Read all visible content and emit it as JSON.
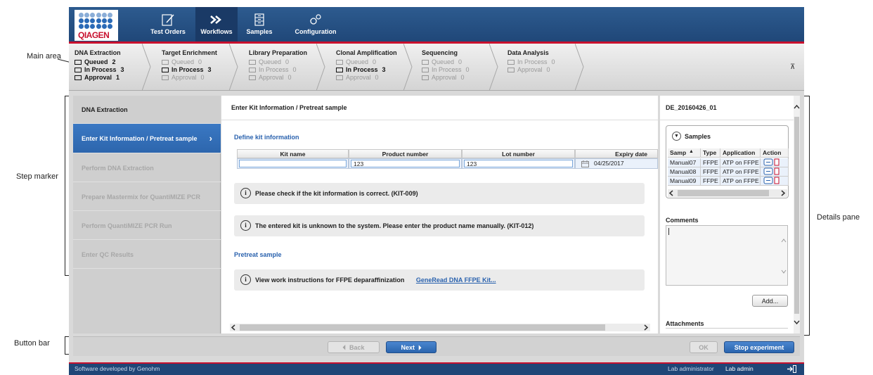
{
  "callouts": {
    "main_area": "Main area",
    "step_marker": "Step marker",
    "details_pane": "Details pane",
    "button_bar": "Button bar"
  },
  "brand": {
    "logo_text": "QIAGEN",
    "color_primary": "#1f4677",
    "color_accent": "#c8102e",
    "color_link": "#2a62ae"
  },
  "nav": [
    {
      "label": "Test Orders",
      "icon": "pencil-icon"
    },
    {
      "label": "Workflows",
      "icon": "double-chevron-icon",
      "active": true
    },
    {
      "label": "Samples",
      "icon": "cabinet-icon"
    },
    {
      "label": "Configuration",
      "icon": "gears-icon"
    }
  ],
  "stages": [
    {
      "name": "DNA Extraction",
      "rows": [
        {
          "label": "Queued",
          "count": "2",
          "on": true
        },
        {
          "label": "In Process",
          "count": "3",
          "on": true
        },
        {
          "label": "Approval",
          "count": "1",
          "on": true
        }
      ]
    },
    {
      "name": "Target Enrichment",
      "rows": [
        {
          "label": "Queued",
          "count": "0"
        },
        {
          "label": "In Process",
          "count": "3",
          "on": true
        },
        {
          "label": "Approval",
          "count": "0"
        }
      ]
    },
    {
      "name": "Library Preparation",
      "rows": [
        {
          "label": "Queued",
          "count": "0"
        },
        {
          "label": "In Process",
          "count": "0"
        },
        {
          "label": "Approval",
          "count": "0"
        }
      ]
    },
    {
      "name": "Clonal Amplification",
      "rows": [
        {
          "label": "Queued",
          "count": "0"
        },
        {
          "label": "In Process",
          "count": "3",
          "on": true
        },
        {
          "label": "Approval",
          "count": "0"
        }
      ]
    },
    {
      "name": "Sequencing",
      "rows": [
        {
          "label": "Queued",
          "count": "0"
        },
        {
          "label": "In Process",
          "count": "0"
        },
        {
          "label": "Approval",
          "count": "0"
        }
      ]
    },
    {
      "name": "Data Analysis",
      "rows": [
        {
          "label": "In Process",
          "count": "0"
        },
        {
          "label": "Approval",
          "count": "0"
        }
      ]
    }
  ],
  "steps": [
    {
      "label": "DNA Extraction",
      "state": "first"
    },
    {
      "label": "Enter Kit Information / Pretreat sample",
      "state": "current"
    },
    {
      "label": "Perform DNA Extraction",
      "state": "pending"
    },
    {
      "label": "Prepare Mastermix for QuantiMIZE PCR",
      "state": "pending"
    },
    {
      "label": "Perform QuantiMIZE PCR Run",
      "state": "pending"
    },
    {
      "label": "Enter QC Results",
      "state": "pending"
    }
  ],
  "main": {
    "title": "Enter Kit Information / Pretreat sample",
    "define_kit_label": "Define kit information",
    "columns": [
      "Kit name",
      "Product number",
      "Lot number",
      "Expiry date"
    ],
    "row": {
      "kit_name": "",
      "product_number": "123",
      "lot_number": "123",
      "expiry_date": "04/25/2017"
    },
    "msg1": "Please check if the kit information is correct. (KIT-009)",
    "msg2": "The entered kit is unknown to the system. Please enter the product name manually. (KIT-012)",
    "pretreat_label": "Pretreat sample",
    "msg3": "View work instructions for FFPE deparaffinization",
    "msg3_link": "GeneRead DNA FFPE Kit..."
  },
  "details": {
    "title": "DE_20160426_01",
    "samples_label": "Samples",
    "sample_columns": [
      "Samp",
      "Type",
      "Application",
      "Action"
    ],
    "samples": [
      {
        "name": "Manual07",
        "type": "FFPE",
        "app": "ATP on FFPE"
      },
      {
        "name": "Manual08",
        "type": "FFPE",
        "app": "ATP on FFPE"
      },
      {
        "name": "Manual09",
        "type": "FFPE",
        "app": "ATP on FFPE"
      }
    ],
    "comments_label": "Comments",
    "add_label": "Add...",
    "attachments_label": "Attachments"
  },
  "buttons": {
    "back": "Back",
    "next": "Next",
    "ok": "OK",
    "stop": "Stop experiment"
  },
  "footer": {
    "left": "Software developed by Genohm",
    "role": "Lab administrator",
    "user": "Lab admin"
  }
}
